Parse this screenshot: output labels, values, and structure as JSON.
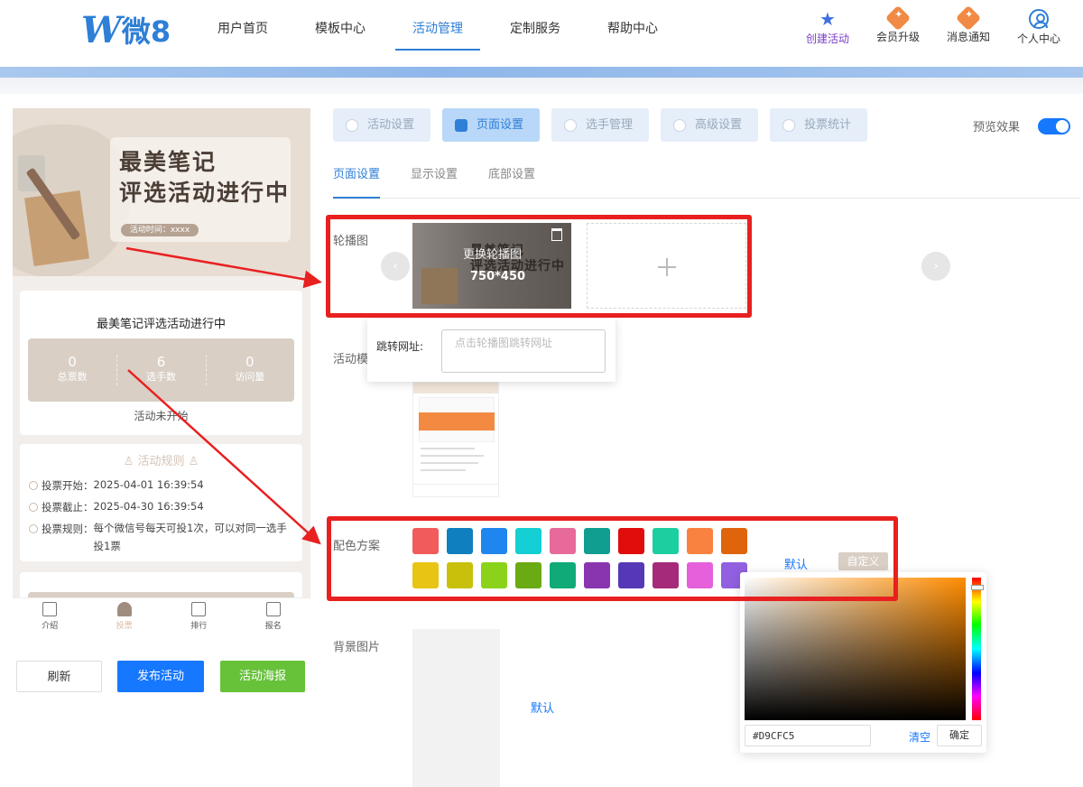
{
  "header": {
    "logo_w": "W",
    "logo_text": "微8",
    "nav": [
      {
        "label": "用户首页",
        "active": false
      },
      {
        "label": "模板中心",
        "active": false
      },
      {
        "label": "活动管理",
        "active": true
      },
      {
        "label": "定制服务",
        "active": false
      },
      {
        "label": "帮助中心",
        "active": false
      }
    ],
    "right_items": {
      "create": "创建活动",
      "upgrade": "会员升级",
      "messages": "消息通知",
      "profile": "个人中心"
    }
  },
  "preview": {
    "banner_line1": "最美笔记",
    "banner_line2": "评选活动进行中",
    "banner_time": "活动时间：xxxx",
    "title": "最美笔记评选活动进行中",
    "stats": [
      {
        "value": "0",
        "label": "总票数"
      },
      {
        "value": "6",
        "label": "选手数"
      },
      {
        "value": "0",
        "label": "访问量"
      }
    ],
    "status": "活动未开始",
    "rules_title": "活动规则",
    "rules": [
      {
        "label": "投票开始：",
        "value": "2025-04-01 16:39:54"
      },
      {
        "label": "投票截止：",
        "value": "2025-04-30 16:39:54"
      },
      {
        "label": "投票规则：",
        "value": "每个微信号每天可投1次，可以对同一选手投1票"
      }
    ],
    "tabbar": [
      {
        "label": "介绍",
        "icon": "doc-icon",
        "active": false
      },
      {
        "label": "投票",
        "icon": "user-icon",
        "active": true
      },
      {
        "label": "排行",
        "icon": "bar-chart-icon",
        "active": false
      },
      {
        "label": "报名",
        "icon": "form-icon",
        "active": false
      }
    ]
  },
  "actions": {
    "refresh": "刷新",
    "publish": "发布活动",
    "poster": "活动海报"
  },
  "settings": {
    "main_tabs": [
      {
        "label": "活动设置",
        "icon": "shield-icon",
        "active": false
      },
      {
        "label": "页面设置",
        "icon": "layout-icon",
        "active": true
      },
      {
        "label": "选手管理",
        "icon": "person-icon",
        "active": false
      },
      {
        "label": "高级设置",
        "icon": "sliders-icon",
        "active": false
      },
      {
        "label": "投票统计",
        "icon": "list-icon",
        "active": false
      }
    ],
    "preview_label": "预览效果",
    "preview_on": true,
    "sub_tabs": [
      {
        "label": "页面设置",
        "active": true
      },
      {
        "label": "显示设置",
        "active": false
      },
      {
        "label": "底部设置",
        "active": false
      }
    ],
    "carousel_label": "轮播图",
    "slide_t1": "最美笔记",
    "slide_t2": "评选活动进行中",
    "slide_overlay": "更换轮播图",
    "slide_size": "750*450",
    "link_label": "跳转网址:",
    "link_placeholder": "点击轮播图跳转网址",
    "template_label": "活动模",
    "color_label": "配色方案",
    "colors_row1": [
      "#f25b5b",
      "#0f7fc0",
      "#1f86ef",
      "#14cfd4",
      "#e86a9b",
      "#0f9e90",
      "#e10d0d",
      "#1ccfa0",
      "#fa8241",
      "#e0640c"
    ],
    "colors_row2": [
      "#e8c414",
      "#c8c00a",
      "#8bd31a",
      "#6aaa12",
      "#0faa78",
      "#8a35b0",
      "#5538b5",
      "#a52a7a",
      "#e660dc",
      "#9160e0"
    ],
    "default_label": "默认",
    "custom_label": "自定义",
    "bg_label": "背景图片",
    "bg_default_label": "默认",
    "picker": {
      "hex": "#D9CFC5",
      "clear": "清空",
      "ok": "确定"
    }
  }
}
